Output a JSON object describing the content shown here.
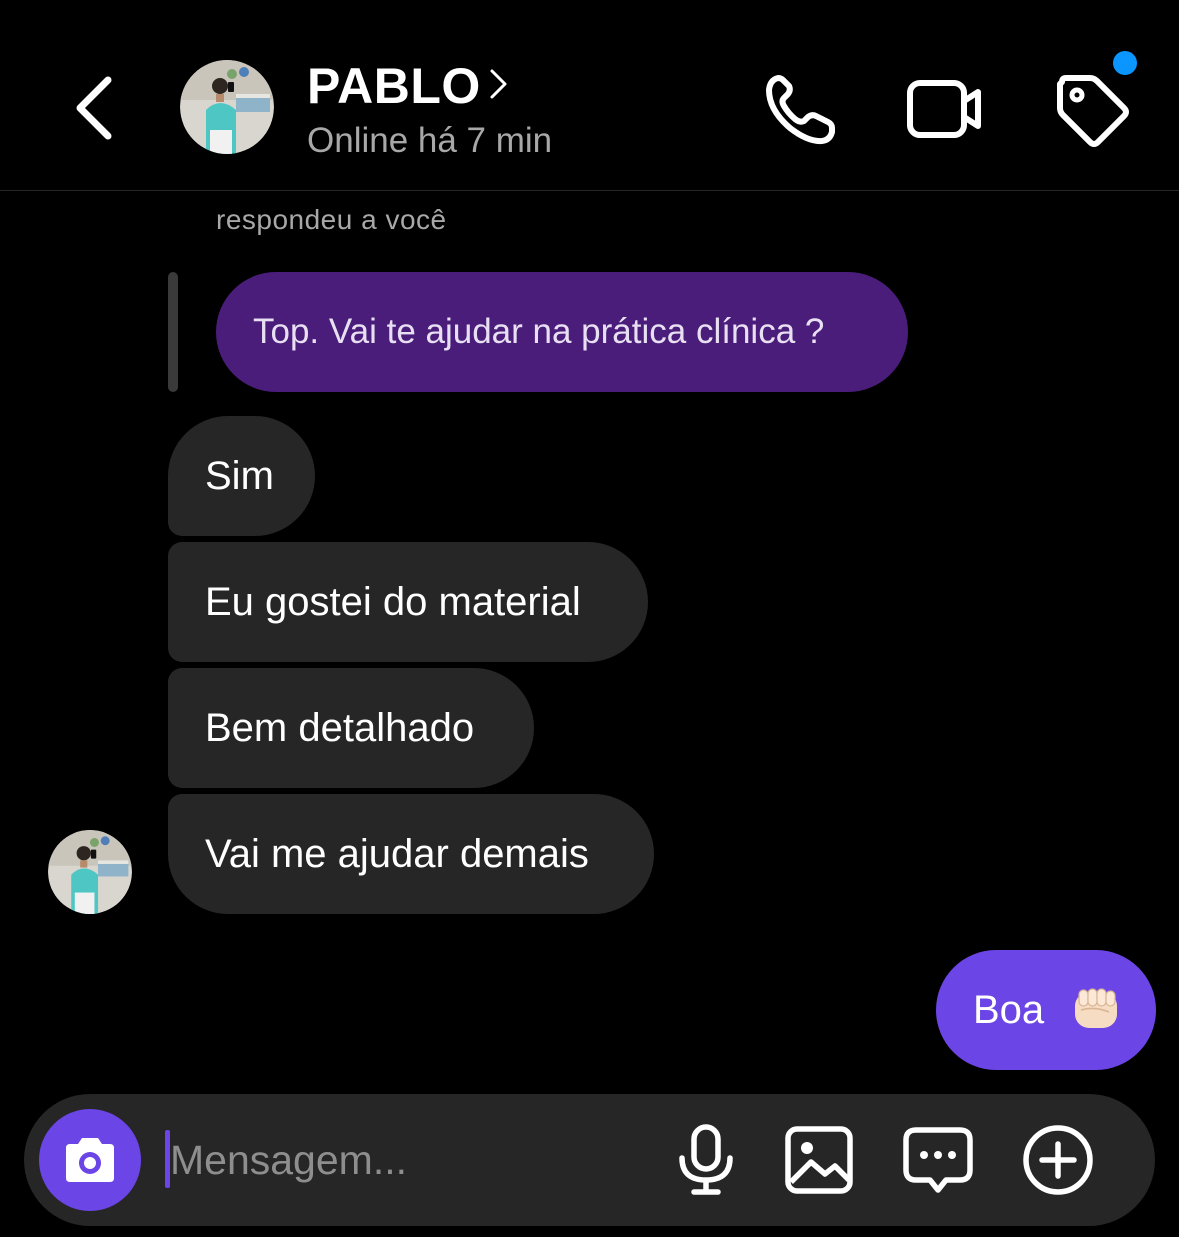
{
  "header": {
    "contact_name": "PABLO",
    "status": "Online há 7 min",
    "notification_dot_color": "#0a95ff"
  },
  "icons": {
    "back": "chevron-left-icon",
    "name_chevron": "chevron-right-icon",
    "call": "phone-icon",
    "video": "video-camera-icon",
    "tag": "tag-icon",
    "camera": "camera-icon",
    "mic": "microphone-icon",
    "gallery": "image-icon",
    "sticker": "chat-bubble-icon",
    "more": "plus-circle-icon",
    "emoji": "oncoming-fist-emoji"
  },
  "thread": {
    "reply_label": "respondeu a você",
    "quoted_message": "Top. Vai te ajudar na prática clínica ?",
    "received": [
      "Sim",
      "Eu gostei do material",
      "Bem detalhado",
      "Vai me ajudar demais"
    ],
    "sent": [
      "Boa"
    ]
  },
  "composer": {
    "placeholder": "Mensagem..."
  },
  "colors": {
    "sent_bubble": "#6b45e6",
    "quoted_bubble": "#4a1d7a",
    "received_bubble": "#262626",
    "background": "#000000"
  }
}
